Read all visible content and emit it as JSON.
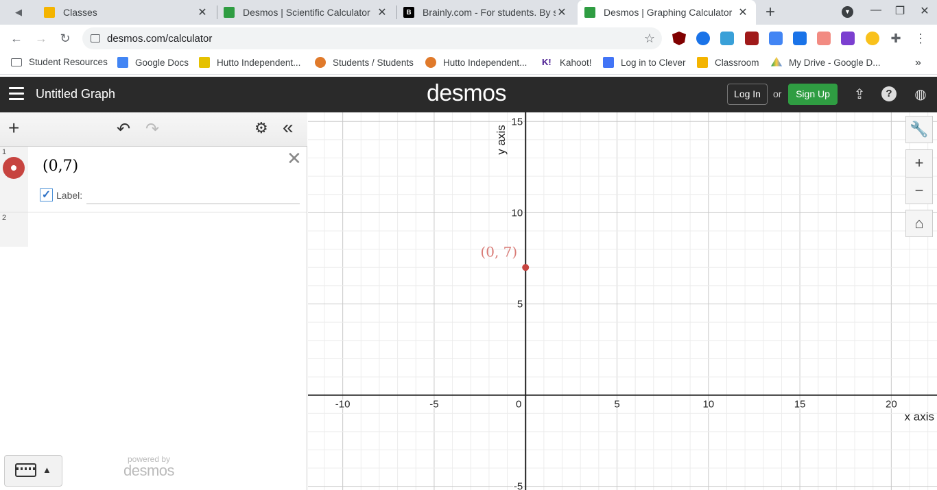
{
  "browser": {
    "tabs": [
      {
        "title": "Classes",
        "favicon_color": "#f4b400",
        "active": false
      },
      {
        "title": "Desmos | Scientific Calculator",
        "favicon_color": "#2f9d42",
        "active": false
      },
      {
        "title": "Brainly.com - For students. By stu",
        "favicon_color": "#000000",
        "active": false
      },
      {
        "title": "Desmos | Graphing Calculator",
        "favicon_color": "#2f9d42",
        "active": true
      }
    ],
    "url": "desmos.com/calculator",
    "bookmarks": [
      {
        "label": "Student Resources",
        "icon": "folder-icon"
      },
      {
        "label": "Google Docs",
        "icon": "docs-icon"
      },
      {
        "label": "Hutto Independent...",
        "icon": "hutto-icon"
      },
      {
        "label": "Students / Students",
        "icon": "students-icon"
      },
      {
        "label": "Hutto Independent...",
        "icon": "hutto2-icon"
      },
      {
        "label": "Kahoot!",
        "icon": "kahoot-icon"
      },
      {
        "label": "Log in to Clever",
        "icon": "clever-icon"
      },
      {
        "label": "Classroom",
        "icon": "classroom-icon"
      },
      {
        "label": "My Drive - Google D...",
        "icon": "drive-icon"
      }
    ],
    "bookmarks_more": "»"
  },
  "desmos": {
    "graph_title": "Untitled Graph",
    "logo": "desmos",
    "login_label": "Log In",
    "or_label": "or",
    "signup_label": "Sign Up",
    "expressions": [
      {
        "index": "1",
        "latex_text": "(0,7)",
        "label_caption": "Label:",
        "label_checked": true,
        "color": "#c74440"
      },
      {
        "index": "2",
        "latex_text": ""
      }
    ],
    "powered_by": "powered by",
    "powered_logo": "desmos"
  },
  "chart_data": {
    "type": "scatter",
    "xlabel": "x axis",
    "ylabel": "y axis",
    "xlim": [
      -11.9,
      22.5
    ],
    "ylim": [
      -5.2,
      15.5
    ],
    "x_ticks": [
      -10,
      -5,
      0,
      5,
      10,
      15,
      20
    ],
    "y_ticks": [
      -5,
      5,
      10,
      15
    ],
    "grid": true,
    "series": [
      {
        "name": "",
        "color": "#c74440",
        "points": [
          {
            "x": 0,
            "y": 7,
            "label": "(0, 7)"
          }
        ]
      }
    ]
  }
}
